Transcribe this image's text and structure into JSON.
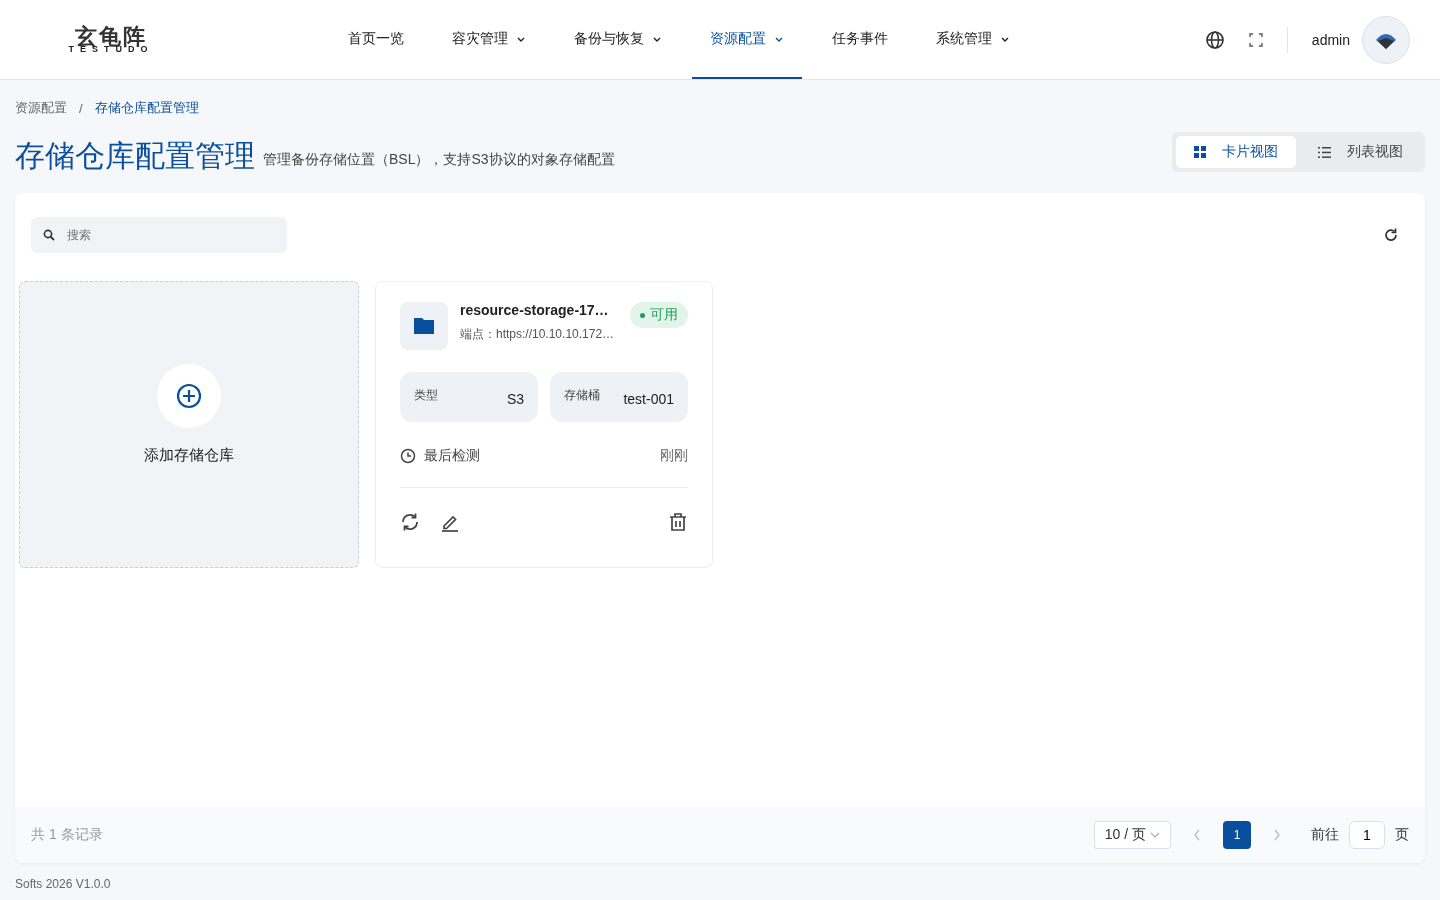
{
  "logo": {
    "name": "玄龟阵",
    "subtitle": "TESTUDO"
  },
  "nav": [
    {
      "label": "首页一览",
      "dropdown": false,
      "selected": false
    },
    {
      "label": "容灾管理",
      "dropdown": true,
      "selected": false
    },
    {
      "label": "备份与恢复",
      "dropdown": true,
      "selected": false
    },
    {
      "label": "资源配置",
      "dropdown": true,
      "selected": true
    },
    {
      "label": "任务事件",
      "dropdown": false,
      "selected": false
    },
    {
      "label": "系统管理",
      "dropdown": true,
      "selected": false
    }
  ],
  "user": {
    "name": "admin"
  },
  "breadcrumb_separator": "/",
  "breadcrumb": [
    {
      "label": "资源配置",
      "selected": false
    },
    {
      "label": "存储仓库配置管理",
      "selected": true
    }
  ],
  "page": {
    "title": "存储仓库配置管理",
    "subtitle": "管理备份存储位置（BSL），支持S3协议的对象存储配置"
  },
  "view_toggle": [
    {
      "label": "卡片视图",
      "kind": "grid",
      "selected": true
    },
    {
      "label": "列表视图",
      "kind": "list",
      "selected": false
    }
  ],
  "search": {
    "placeholder": "搜索"
  },
  "add_card": {
    "label": "添加存储仓库"
  },
  "repositories": [
    {
      "name": "resource-storage-17…",
      "status": "可用",
      "color": "#1f9d55",
      "endpoint": "端点：https://10.10.10.172…",
      "type_label": "类型",
      "type": "S3",
      "bucket_label": "存储桶",
      "bucket": "test-001",
      "check_label": "最后检测",
      "check_time": "刚刚"
    }
  ],
  "pagination": {
    "total": "共 1 条记录",
    "page_size": "10 / 页",
    "pages": [
      {
        "label": "1",
        "selected": true
      }
    ],
    "goto_label": "前往",
    "goto_value": "1",
    "goto_suffix": "页"
  },
  "footer": "Softs 2026 V1.0.0"
}
